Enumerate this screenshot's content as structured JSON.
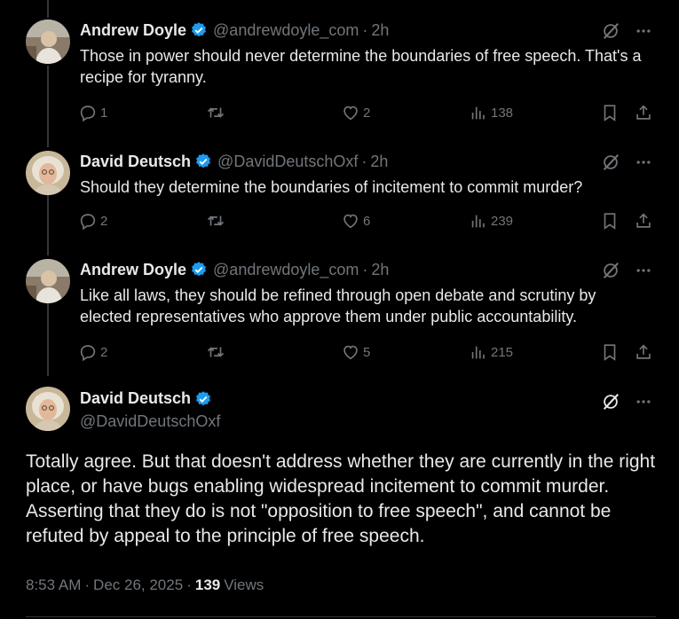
{
  "replies": [
    {
      "name": "Andrew Doyle",
      "handle": "@andrewdoyle_com",
      "sep": "·",
      "time": "2h",
      "text": "Those in power should never determine the boundaries of free speech. That's a recipe for tyranny.",
      "replies": "1",
      "retweets": "",
      "likes": "2",
      "views": "138"
    },
    {
      "name": "David Deutsch",
      "handle": "@DavidDeutschOxf",
      "sep": "·",
      "time": "2h",
      "text": "Should they determine the boundaries of incitement to commit murder?",
      "replies": "2",
      "retweets": "",
      "likes": "6",
      "views": "239"
    },
    {
      "name": "Andrew Doyle",
      "handle": "@andrewdoyle_com",
      "sep": "·",
      "time": "2h",
      "text": "Like all laws, they should be refined through open debate and scrutiny by elected representatives who approve them under public accountability.",
      "replies": "2",
      "retweets": "",
      "likes": "5",
      "views": "215"
    }
  ],
  "main": {
    "name": "David Deutsch",
    "handle": "@DavidDeutschOxf",
    "text": "Totally agree. But that doesn't address whether they are currently in the right place, or have bugs enabling widespread incitement to commit murder.  Asserting that they do is not \"opposition to free speech\", and cannot be refuted by appeal to the principle of free speech.",
    "time": "8:53 AM",
    "date": "Dec 26, 2025",
    "sep": "·",
    "views_count": "139",
    "views_label": "Views"
  },
  "colors": {
    "background": "#000000",
    "text": "#e7e9ea",
    "muted": "#71767b",
    "verified": "#1d9bf0"
  },
  "icons": [
    "verified-badge-icon",
    "grok-icon",
    "more-icon",
    "reply-icon",
    "retweet-icon",
    "like-icon",
    "views-icon",
    "bookmark-icon",
    "share-icon"
  ]
}
